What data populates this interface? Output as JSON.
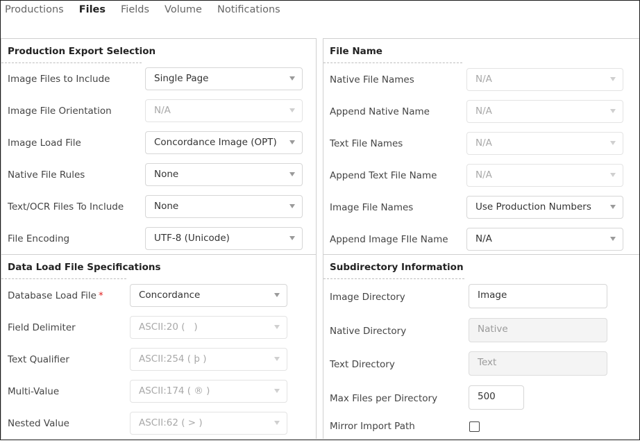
{
  "tabs": [
    {
      "label": "Productions",
      "active": false
    },
    {
      "label": "Files",
      "active": true
    },
    {
      "label": "Fields",
      "active": false
    },
    {
      "label": "Volume",
      "active": false
    },
    {
      "label": "Notifications",
      "active": false
    }
  ],
  "production_export": {
    "title": "Production Export Selection",
    "rows": [
      {
        "label": "Image Files to Include",
        "value": "Single Page",
        "disabled": false
      },
      {
        "label": "Image File Orientation",
        "value": "N/A",
        "disabled": true
      },
      {
        "label": "Image Load File",
        "value": "Concordance Image (OPT)",
        "disabled": false
      },
      {
        "label": "Native File Rules",
        "value": "None",
        "disabled": false
      },
      {
        "label": "Text/OCR Files To Include",
        "value": "None",
        "disabled": false
      },
      {
        "label": "File Encoding",
        "value": "UTF-8 (Unicode)",
        "disabled": false
      }
    ]
  },
  "data_load": {
    "title": "Data Load File Specifications",
    "rows": [
      {
        "label": "Database Load File",
        "required": "*",
        "value": "Concordance",
        "disabled": false
      },
      {
        "label": "Field Delimiter",
        "value": "ASCII:20 (   )",
        "disabled": true
      },
      {
        "label": "Text Qualifier",
        "value": "ASCII:254 ( þ )",
        "disabled": true
      },
      {
        "label": "Multi-Value",
        "value": "ASCII:174 ( ® )",
        "disabled": true
      },
      {
        "label": "Nested Value",
        "value": "ASCII:62 ( > )",
        "disabled": true
      }
    ]
  },
  "file_name": {
    "title": "File Name",
    "rows": [
      {
        "label": "Native File Names",
        "value": "N/A",
        "disabled": true
      },
      {
        "label": "Append Native Name",
        "value": "N/A",
        "disabled": true
      },
      {
        "label": "Text File Names",
        "value": "N/A",
        "disabled": true
      },
      {
        "label": "Append Text File Name",
        "value": "N/A",
        "disabled": true
      },
      {
        "label": "Image File Names",
        "value": "Use Production Numbers",
        "disabled": false
      },
      {
        "label": "Append Image FIle Name",
        "value": "N/A",
        "disabled": false
      }
    ]
  },
  "subdirectory": {
    "title": "Subdirectory Information",
    "rows": [
      {
        "label": "Image Directory",
        "value": "Image",
        "disabled": false
      },
      {
        "label": "Native Directory",
        "value": "Native",
        "disabled": true
      },
      {
        "label": "Text Directory",
        "value": "Text",
        "disabled": true
      },
      {
        "label": "Max Files per Directory",
        "value": "500",
        "disabled": false
      },
      {
        "label": "Mirror Import Path",
        "checked": false
      }
    ]
  }
}
